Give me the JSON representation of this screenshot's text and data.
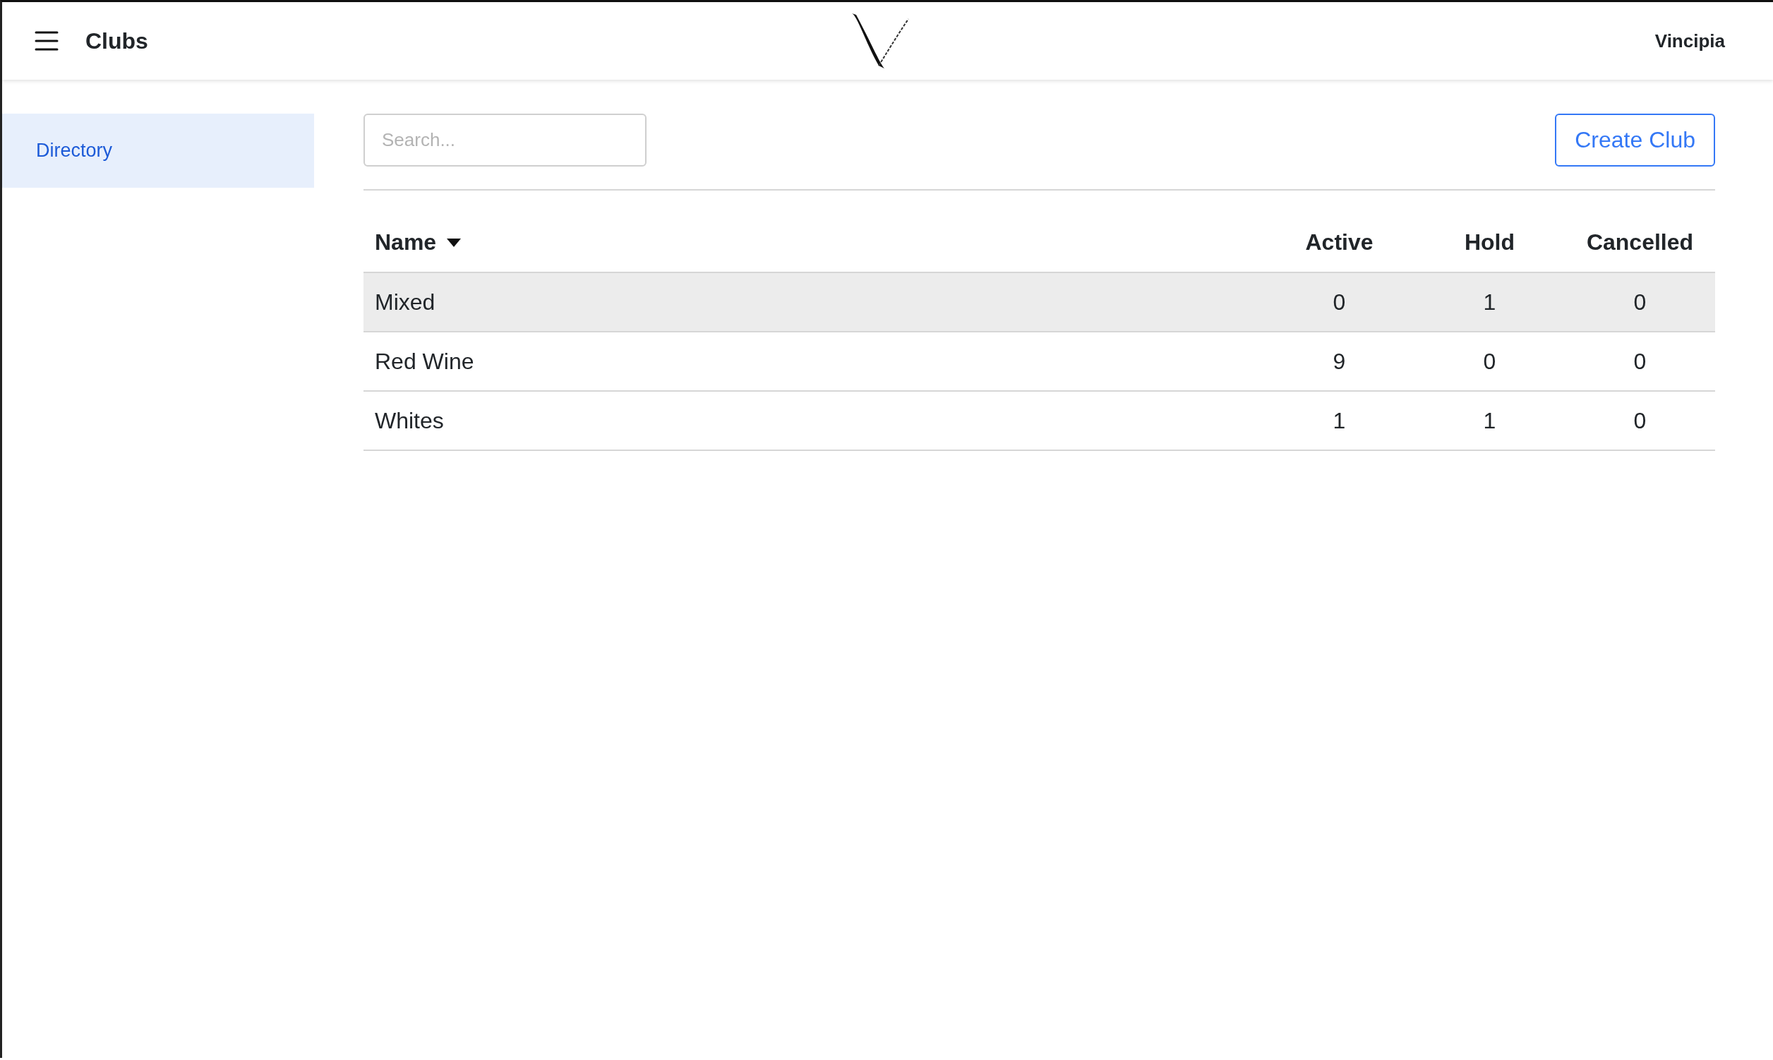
{
  "header": {
    "title": "Clubs",
    "account": "Vincipia"
  },
  "sidebar": {
    "items": [
      {
        "label": "Directory",
        "selected": true
      }
    ]
  },
  "search": {
    "placeholder": "Search..."
  },
  "create_button": "Create Club",
  "table": {
    "columns": [
      {
        "label": "Name",
        "sorted": true
      },
      {
        "label": "Active",
        "sorted": false
      },
      {
        "label": "Hold",
        "sorted": false
      },
      {
        "label": "Cancelled",
        "sorted": false
      }
    ],
    "rows": [
      {
        "cells": [
          "Mixed",
          "0",
          "1",
          "0"
        ],
        "highlighted": true
      },
      {
        "cells": [
          "Red Wine",
          "9",
          "0",
          "0"
        ],
        "highlighted": false
      },
      {
        "cells": [
          "Whites",
          "1",
          "1",
          "0"
        ],
        "highlighted": false
      }
    ]
  }
}
